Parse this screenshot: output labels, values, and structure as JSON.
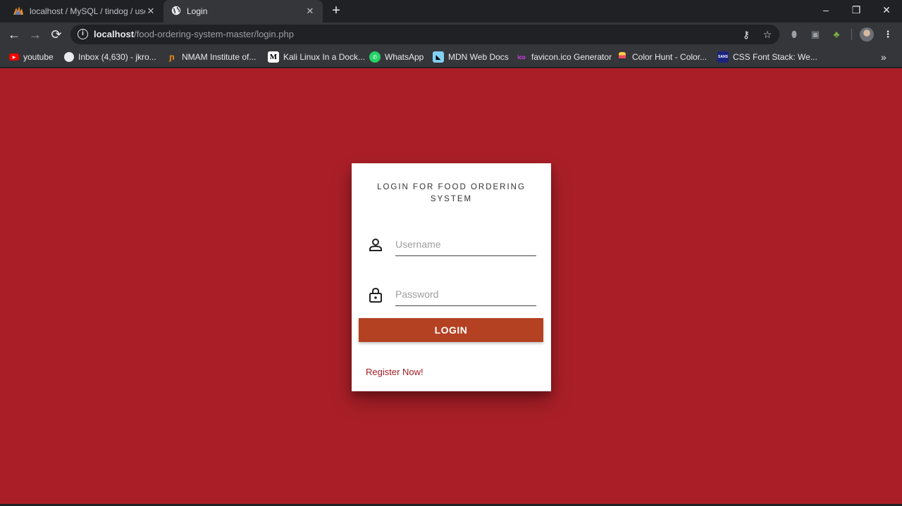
{
  "browser": {
    "tabs": [
      {
        "title": "localhost / MySQL / tindog / use",
        "icon": "phpmyadmin-icon"
      },
      {
        "title": "Login",
        "icon": "globe-icon",
        "active": true
      }
    ],
    "url": {
      "host": "localhost",
      "path": "/food-ordering-system-master/login.php"
    },
    "bookmarks": [
      {
        "label": "youtube",
        "icon": "youtube-icon"
      },
      {
        "label": "Inbox (4,630) - jkro...",
        "icon": "globe-icon"
      },
      {
        "label": "NMAM Institute of...",
        "icon": "nmam-icon"
      },
      {
        "label": "Kali Linux In a Dock...",
        "icon": "medium-icon"
      },
      {
        "label": "WhatsApp",
        "icon": "whatsapp-icon"
      },
      {
        "label": "MDN Web Docs",
        "icon": "mdn-icon"
      },
      {
        "label": "favicon.ico Generator",
        "icon": "favicon-generator-icon"
      },
      {
        "label": "Color Hunt - Color...",
        "icon": "colorhunt-icon"
      },
      {
        "label": "CSS Font Stack: We...",
        "icon": "cssfontstack-icon"
      }
    ]
  },
  "login": {
    "title": "LOGIN FOR FOOD ORDERING SYSTEM",
    "username_placeholder": "Username",
    "password_placeholder": "Password",
    "button_label": "LOGIN",
    "register_link": "Register Now!"
  },
  "colors": {
    "page_background": "#aa1f27",
    "button": "#b34122",
    "link": "#a31d23"
  }
}
